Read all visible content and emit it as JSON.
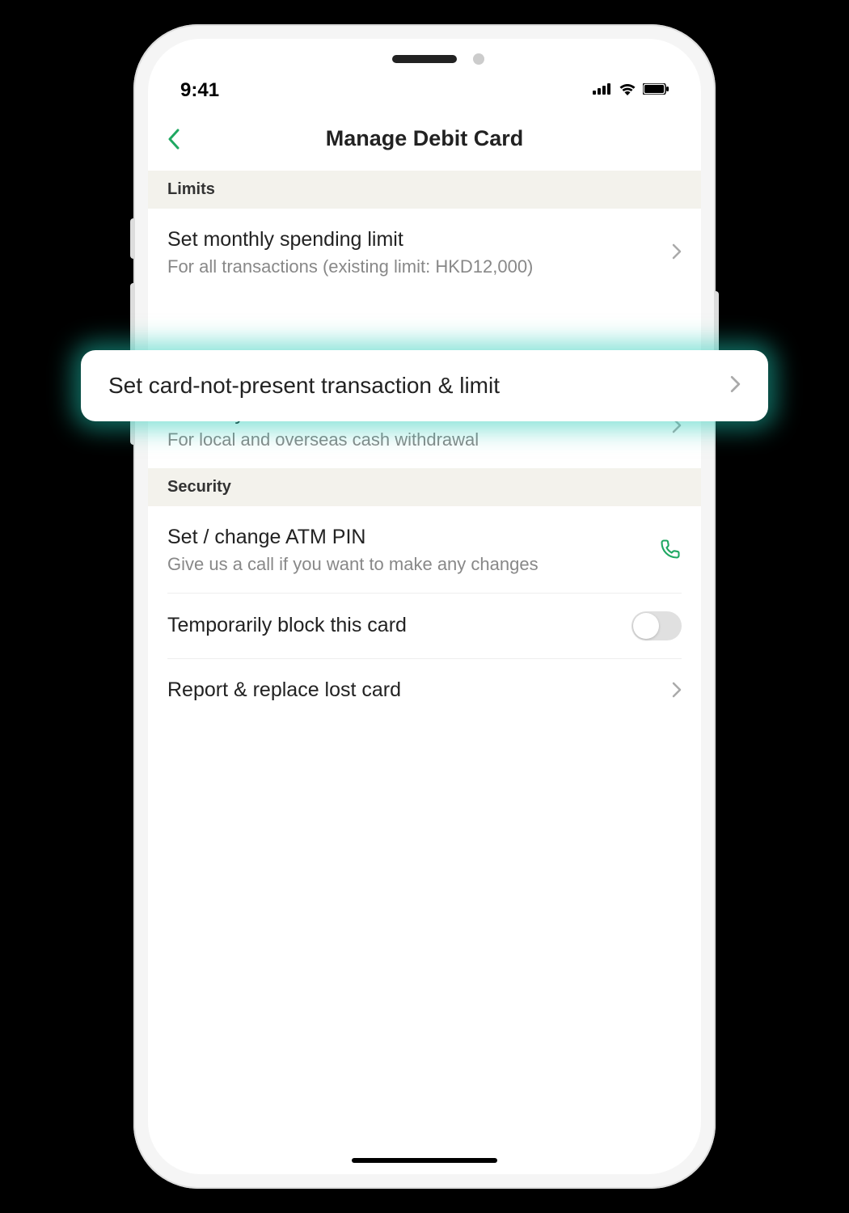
{
  "statusBar": {
    "time": "9:41"
  },
  "header": {
    "title": "Manage Debit Card"
  },
  "sections": {
    "limits": {
      "label": "Limits",
      "items": [
        {
          "title": "Set monthly spending limit",
          "subtitle": "For all transactions (existing limit: HKD12,000)"
        },
        {
          "title": "Set card-not-present transaction & limit"
        },
        {
          "title": "Set daily ATM withdrawal limit",
          "subtitle": "For local and overseas cash withdrawal"
        }
      ]
    },
    "security": {
      "label": "Security",
      "items": [
        {
          "title": "Set / change ATM PIN",
          "subtitle": "Give us a call if you want to make any changes"
        },
        {
          "title": "Temporarily block this card"
        },
        {
          "title": "Report & replace lost card"
        }
      ]
    }
  },
  "highlight": {
    "title": "Set card-not-present transaction & limit"
  },
  "colors": {
    "accent": "#1fa862",
    "highlightGlow": "#1ec8b4"
  }
}
